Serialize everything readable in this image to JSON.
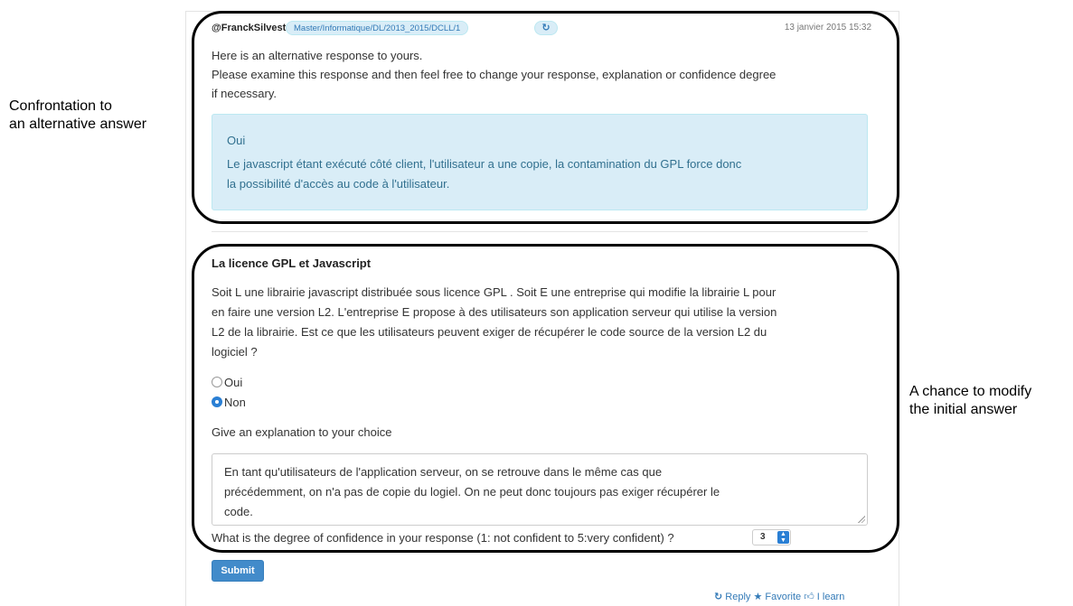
{
  "annotations": {
    "left": [
      "Confrontation to",
      "an alternative answer"
    ],
    "right": [
      "A chance to modify",
      "the initial answer"
    ]
  },
  "post": {
    "author": "@FranckSilvestre",
    "tag": "Master/Informatique/DL/2013_2015/DCLL/1",
    "tag_button_icon": "refresh-icon",
    "date": "13 janvier 2015 15:32",
    "intro_lines": [
      "Here is an alternative response to yours.",
      "Please examine this response and then feel free to change your response, explanation or confidence degree",
      "if necessary."
    ],
    "alternative": {
      "answer": "Oui",
      "explanation_lines": [
        "Le javascript étant exécuté côté client, l'utilisateur a une copie, la contamination du GPL force donc",
        "la possibilité d'accès au code à l'utilisateur."
      ]
    }
  },
  "question": {
    "title": "La licence GPL et Javascript",
    "text_lines": [
      "Soit L une librairie javascript distribuée sous licence GPL . Soit E une entreprise qui modifie la librairie L pour",
      "en faire une version L2. L'entreprise E propose à des utilisateurs son application serveur qui utilise la version",
      "L2 de la librairie. Est ce que les utilisateurs peuvent exiger de récupérer le code source de la version L2 du",
      "logiciel ?"
    ],
    "options": [
      {
        "label": "Oui",
        "selected": false
      },
      {
        "label": "Non",
        "selected": true
      }
    ],
    "explanation_label": "Give an explanation to your choice",
    "explanation_lines": [
      "En tant qu'utilisateurs de l'application serveur, on se retrouve dans le même cas que",
      "précédemment, on n'a pas de copie du logiel. On  ne peut donc toujours pas exiger récupérer le",
      "code."
    ],
    "confidence_label": "What is the degree of confidence in your response (1: not confident to 5:very confident) ?",
    "confidence_value": "3",
    "submit_label": "Submit"
  },
  "footer": {
    "reply": "Reply",
    "favorite": "Favorite",
    "learn": "I learn"
  },
  "colors": {
    "accent": "#428bca",
    "info_bg": "#d9edf7",
    "info_text": "#31708f",
    "link": "#337ab7"
  }
}
